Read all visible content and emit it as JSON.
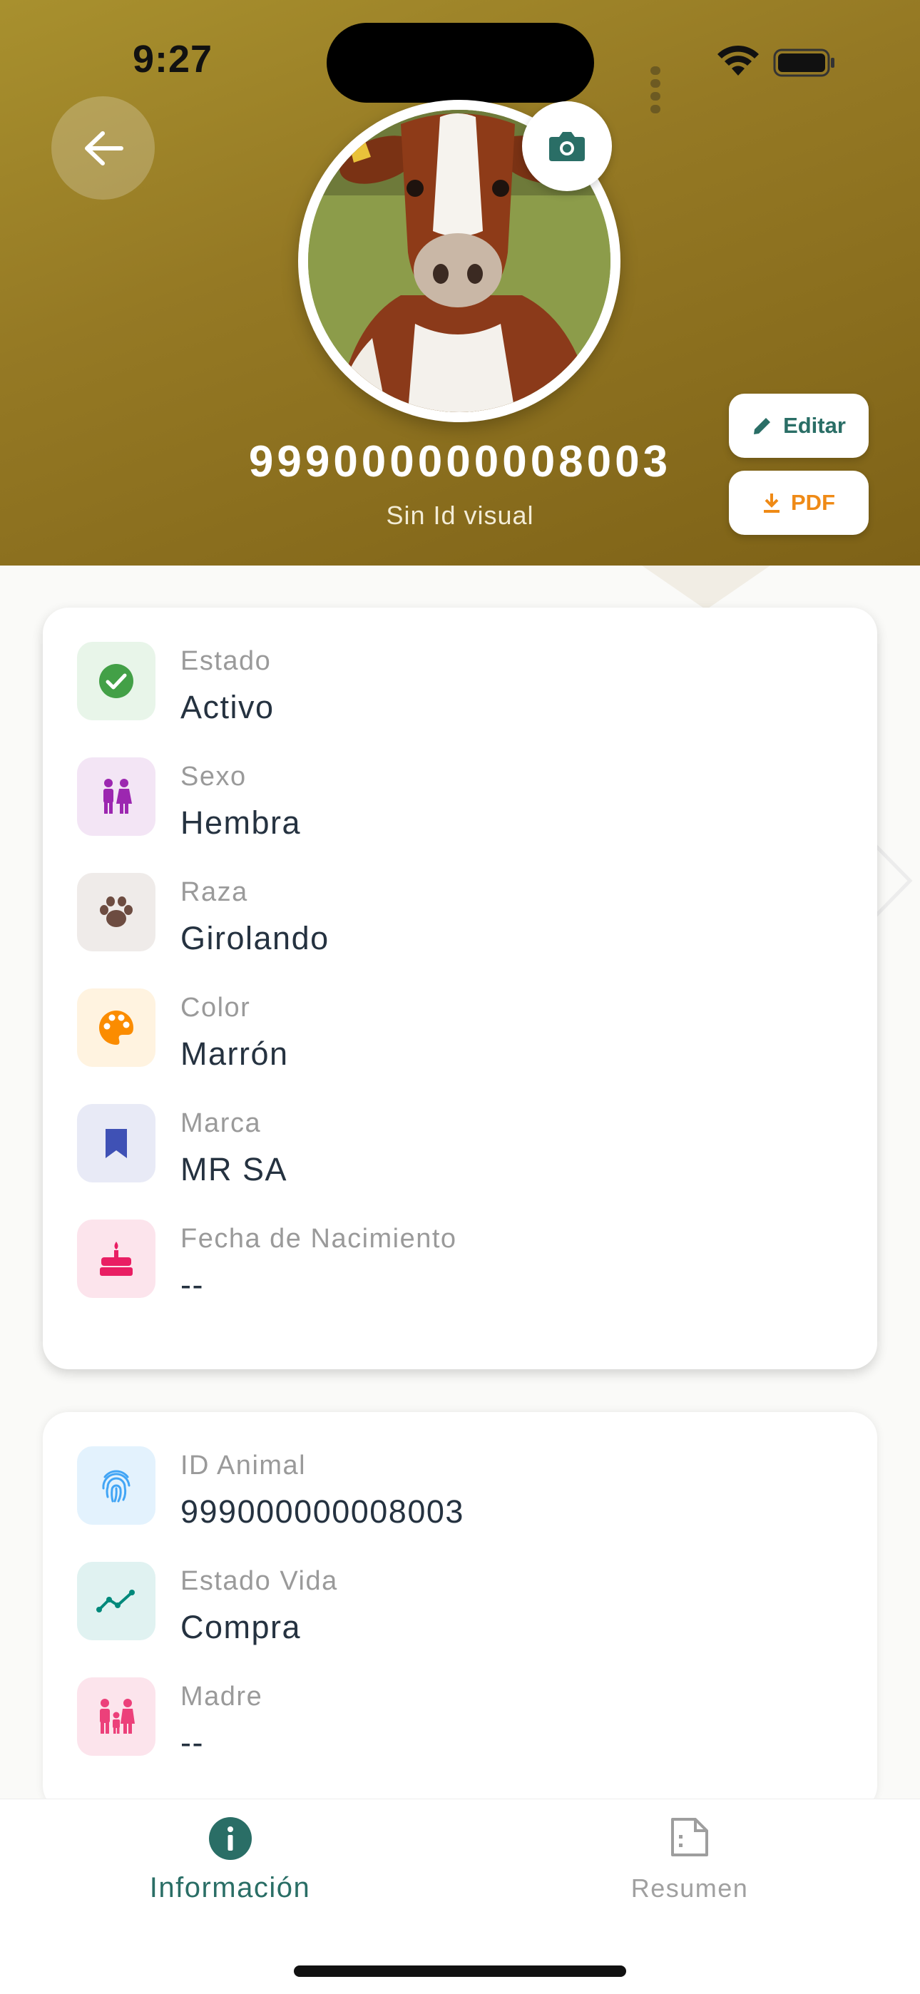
{
  "status_bar": {
    "time": "9:27"
  },
  "header": {
    "animal_number": "999000000008003",
    "visual_id": "Sin Id visual",
    "edit_label": "Editar",
    "pdf_label": "PDF",
    "colors": {
      "gradient_start": "#a8902e",
      "gradient_end": "#7e6217",
      "accent": "#2a6e66",
      "pdf": "#ef8a16"
    }
  },
  "details_card": {
    "rows": [
      {
        "label": "Estado",
        "value": "Activo",
        "icon": "check-circle-icon",
        "icon_color": "#43a047",
        "icon_bg": "#e8f5e9"
      },
      {
        "label": "Sexo",
        "value": "Hembra",
        "icon": "gender-icon",
        "icon_color": "#9c27b0",
        "icon_bg": "#f3e5f5"
      },
      {
        "label": "Raza",
        "value": "Girolando",
        "icon": "paw-icon",
        "icon_color": "#6d4c41",
        "icon_bg": "#efebe9"
      },
      {
        "label": "Color",
        "value": "Marrón",
        "icon": "palette-icon",
        "icon_color": "#fb8c00",
        "icon_bg": "#fff3e0"
      },
      {
        "label": "Marca",
        "value": "MR SA",
        "icon": "bookmark-icon",
        "icon_color": "#3f51b5",
        "icon_bg": "#e8eaf6"
      },
      {
        "label": "Fecha de Nacimiento",
        "value": "--",
        "icon": "cake-icon",
        "icon_color": "#e91e63",
        "icon_bg": "#fce4ec"
      }
    ]
  },
  "ids_card": {
    "rows": [
      {
        "label": "ID Animal",
        "value": "999000000008003",
        "icon": "fingerprint-icon",
        "icon_color": "#42a5f5",
        "icon_bg": "#e3f2fd"
      },
      {
        "label": "Estado Vida",
        "value": "Compra",
        "icon": "trend-icon",
        "icon_color": "#00897b",
        "icon_bg": "#e0f2f1"
      },
      {
        "label": "Madre",
        "value": "--",
        "icon": "family-icon",
        "icon_color": "#ec407a",
        "icon_bg": "#fce4ec"
      }
    ]
  },
  "bottom_nav": {
    "info_label": "Información",
    "summary_label": "Resumen",
    "active": "Información"
  }
}
